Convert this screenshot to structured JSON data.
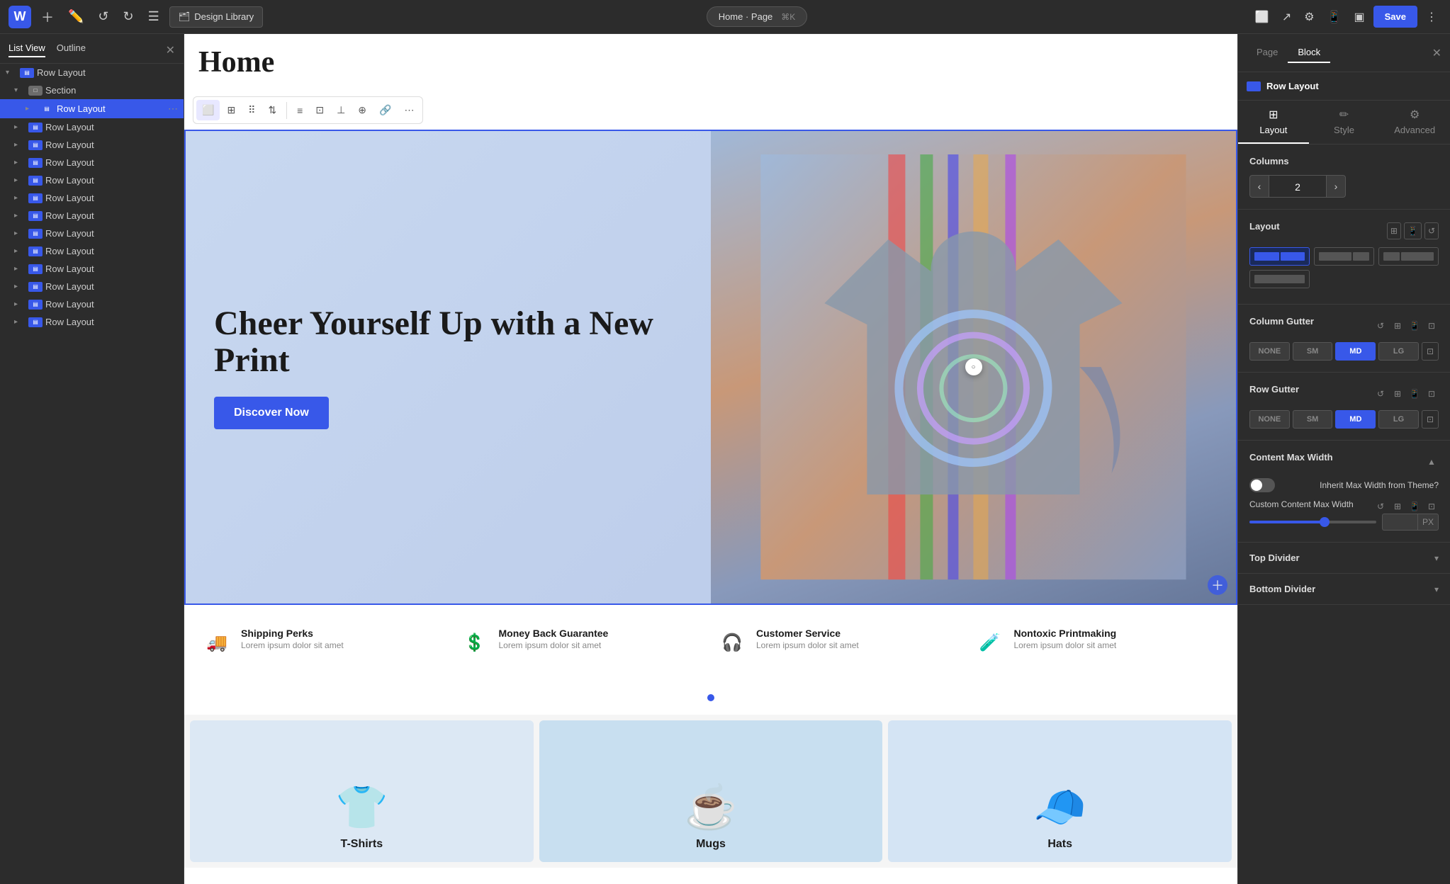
{
  "topbar": {
    "logo": "W",
    "design_library": "Design Library",
    "page_title": "Home · Page",
    "shortcut": "⌘K",
    "save_label": "Save"
  },
  "left_panel": {
    "tab_list_view": "List View",
    "tab_outline": "Outline",
    "items": [
      {
        "label": "Row Layout",
        "level": 0,
        "type": "row",
        "expanded": true
      },
      {
        "label": "Section",
        "level": 1,
        "type": "section",
        "expanded": true
      },
      {
        "label": "Row Layout",
        "level": 2,
        "type": "row",
        "active": true
      },
      {
        "label": "Row Layout",
        "level": 1,
        "type": "row"
      },
      {
        "label": "Row Layout",
        "level": 1,
        "type": "row"
      },
      {
        "label": "Row Layout",
        "level": 1,
        "type": "row"
      },
      {
        "label": "Row Layout",
        "level": 1,
        "type": "row"
      },
      {
        "label": "Row Layout",
        "level": 1,
        "type": "row"
      },
      {
        "label": "Row Layout",
        "level": 1,
        "type": "row"
      },
      {
        "label": "Row Layout",
        "level": 1,
        "type": "row"
      },
      {
        "label": "Row Layout",
        "level": 1,
        "type": "row"
      },
      {
        "label": "Row Layout",
        "level": 1,
        "type": "row"
      },
      {
        "label": "Row Layout",
        "level": 1,
        "type": "row"
      },
      {
        "label": "Row Layout",
        "level": 1,
        "type": "row"
      },
      {
        "label": "Row Layout",
        "level": 1,
        "type": "row"
      }
    ]
  },
  "canvas": {
    "page_title": "Home",
    "hero_title": "Cheer Yourself Up with a New Print",
    "hero_btn": "Discover Now",
    "features": [
      {
        "icon": "🚚",
        "title": "Shipping Perks",
        "desc": "Lorem ipsum dolor sit amet"
      },
      {
        "icon": "💲",
        "title": "Money Back Guarantee",
        "desc": "Lorem ipsum dolor sit amet"
      },
      {
        "icon": "🎧",
        "title": "Customer Service",
        "desc": "Lorem ipsum dolor sit amet"
      },
      {
        "icon": "🧪",
        "title": "Nontoxic Printmaking",
        "desc": "Lorem ipsum dolor sit amet"
      }
    ],
    "products": [
      {
        "label": "T-Shirts",
        "icon": "👕",
        "bg": "#e0e8f2"
      },
      {
        "label": "Mugs",
        "icon": "☕",
        "bg": "#d0e8f4"
      },
      {
        "label": "Hats",
        "icon": "🧢",
        "bg": "#d8e4f0"
      }
    ]
  },
  "right_panel": {
    "tab_page": "Page",
    "tab_block": "Block",
    "block_name": "Row Layout",
    "layout_tab": "Layout",
    "style_tab": "Style",
    "advanced_tab": "Advanced",
    "columns_label": "Columns",
    "columns_value": "2",
    "layout_label": "Layout",
    "column_gutter_label": "Column Gutter",
    "row_gutter_label": "Row Gutter",
    "gutter_options": [
      "NONE",
      "SM",
      "MD",
      "LG"
    ],
    "content_max_width_label": "Content Max Width",
    "inherit_label": "Inherit Max Width from Theme?",
    "custom_width_label": "Custom Content Max Width",
    "width_unit": "PX",
    "top_divider_label": "Top Divider",
    "bottom_divider_label": "Bottom Divider"
  }
}
